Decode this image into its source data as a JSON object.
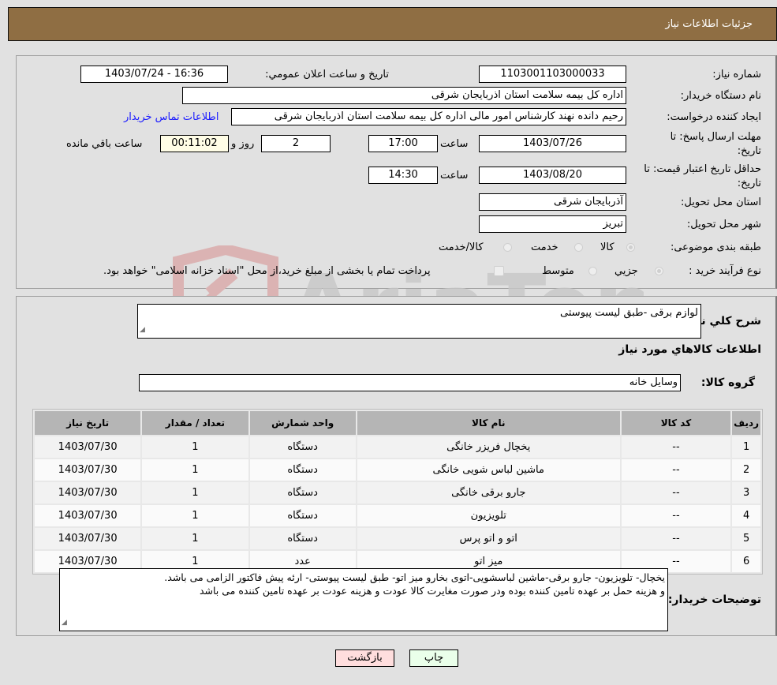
{
  "header": {
    "title": "جزئیات اطلاعات نیاز"
  },
  "form": {
    "need_number": {
      "label": "شماره نیاز:",
      "value": "1103001103000033"
    },
    "announce_datetime": {
      "label": "تاریخ و ساعت اعلان عمومي:",
      "value": "1403/07/24 - 16:36"
    },
    "buyer_org": {
      "label": "نام دستگاه خریدار:",
      "value": "اداره کل بیمه سلامت استان اذربایجان شرقی"
    },
    "requester": {
      "label": "ایجاد کننده درخواست:",
      "value": "رحیم  دانده نهند کارشناس امور مالی اداره کل بیمه سلامت استان اذربایجان شرقی",
      "contact_link": "اطلاعات تماس خریدار"
    },
    "reply_deadline": {
      "label_line1": "مهلت ارسال پاسخ: تا",
      "label_line2": "تاریخ:",
      "date": "1403/07/26",
      "time_label": "ساعت",
      "time": "17:00",
      "days": "2",
      "days_label": "روز و",
      "remaining": "00:11:02",
      "remaining_label": "ساعت باقي مانده"
    },
    "price_validity": {
      "label_line1": "حداقل تاریخ اعتبار قیمت: تا",
      "label_line2": "تاریخ:",
      "date": "1403/08/20",
      "time_label": "ساعت",
      "time": "14:30"
    },
    "delivery_province": {
      "label": "استان محل تحویل:",
      "value": "آذربایجان شرقی"
    },
    "delivery_city": {
      "label": "شهر محل تحویل:",
      "value": "تبریز"
    },
    "category": {
      "label": "طبقه بندی موضوعی:",
      "options": [
        "کالا",
        "خدمت",
        "کالا/خدمت"
      ],
      "selected": "کالا"
    },
    "purchase_type": {
      "label": "نوع فرآیند خرید :",
      "options": [
        "جزيي",
        "متوسط"
      ],
      "selected": "جزيي",
      "note": "پرداخت تمام یا بخشی از مبلغ خرید،از محل \"اسناد خزانه اسلامی\" خواهد بود."
    }
  },
  "details": {
    "general_desc_label": "شرح کلي نیاز:",
    "general_desc": "لوازم برقی -طبق لیست پیوستی",
    "goods_info_title": "اطلاعات کالاهاي مورد نیاز",
    "goods_group_label": "گروه کالا:",
    "goods_group": "وسایل خانه",
    "table": {
      "headers": [
        "ردیف",
        "کد کالا",
        "نام کالا",
        "واحد شمارش",
        "تعداد / مقدار",
        "تاریخ نیاز"
      ],
      "rows": [
        [
          "1",
          "--",
          "یخچال فریزر خانگی",
          "دستگاه",
          "1",
          "1403/07/30"
        ],
        [
          "2",
          "--",
          "ماشین لباس شویی خانگی",
          "دستگاه",
          "1",
          "1403/07/30"
        ],
        [
          "3",
          "--",
          "جارو برقی خانگی",
          "دستگاه",
          "1",
          "1403/07/30"
        ],
        [
          "4",
          "--",
          "تلویزیون",
          "دستگاه",
          "1",
          "1403/07/30"
        ],
        [
          "5",
          "--",
          "اتو و اتو پرس",
          "دستگاه",
          "1",
          "1403/07/30"
        ],
        [
          "6",
          "--",
          "میز اتو",
          "عدد",
          "1",
          "1403/07/30"
        ]
      ]
    },
    "buyer_notes_label": "توضیحات خریدار:",
    "buyer_notes_line1": "یخچال- تلویزیون- جارو برقی-ماشین لباسشویی-اتوی بخارو میز اتو- طبق لیست پیوستی- ارئه پیش فاکتور الزامی می باشد.",
    "buyer_notes_line2": "و هزینه حمل بر عهده تامین کننده بوده ودر صورت مغایرت کالا عودت و هزینه عودت بر عهده تامین کننده می باشد"
  },
  "buttons": {
    "print": "چاپ",
    "back": "بازگشت"
  },
  "colors": {
    "header_bg": "#8f6e43",
    "print_bg": "#eaffea",
    "back_bg": "#ffdede",
    "link": "#1a1aff",
    "remaining_bg": "#fffde6"
  }
}
